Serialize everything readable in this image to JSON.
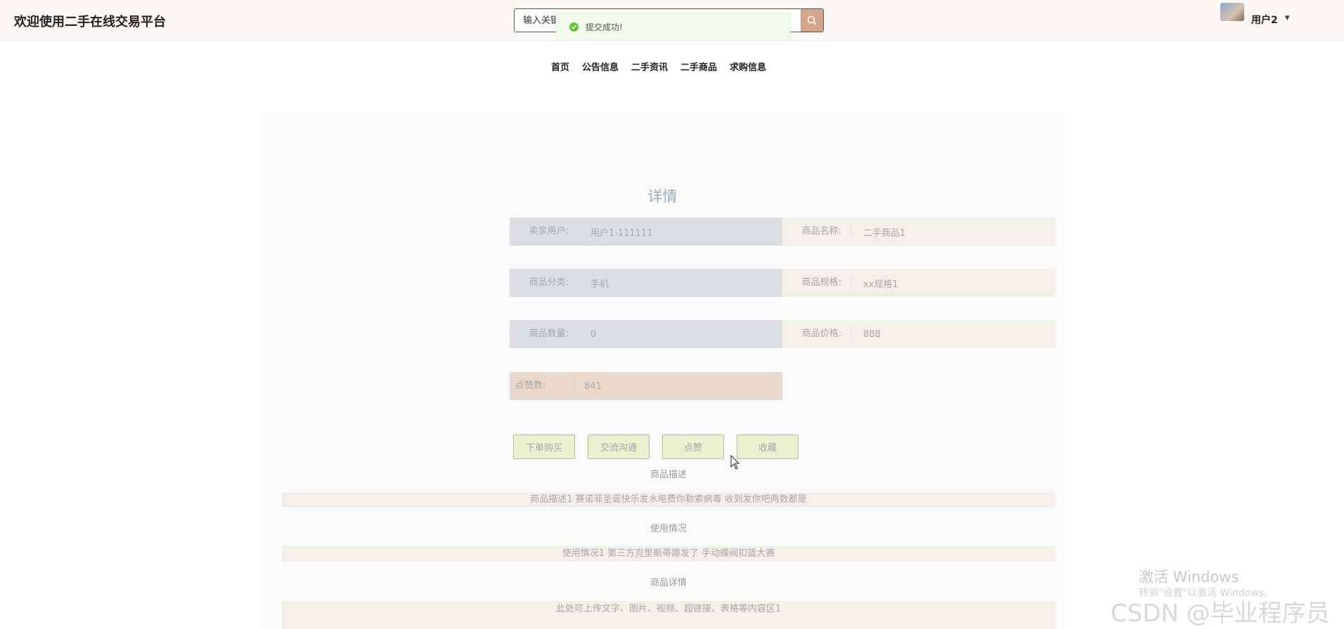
{
  "header": {
    "site_title": "欢迎使用二手在线交易平台",
    "search_placeholder": "输入关键",
    "user_name": "用户2",
    "toast": "提交成功!"
  },
  "nav": [
    "首页",
    "公告信息",
    "二手资讯",
    "二手商品",
    "求购信息"
  ],
  "detail": {
    "title": "详情",
    "fields": {
      "seller_label": "卖家用户:",
      "seller_value": "用户1-111111",
      "name_label": "商品名称:",
      "name_value": "二手商品1",
      "category_label": "商品分类:",
      "category_value": "手机",
      "spec_label": "商品规格:",
      "spec_value": "xx规格1",
      "qty_label": "商品数量:",
      "qty_value": "0",
      "price_label": "商品价格:",
      "price_value": "888",
      "likes_label": "点赞数:",
      "likes_value": "841"
    },
    "buttons": [
      "下单购买",
      "交流沟通",
      "点赞",
      "收藏"
    ],
    "sections": {
      "desc_title": "商品描述",
      "desc_body": "商品描述1 赛诺菲圣诞快乐发水电费你勒索病毒 收到发你吧两数都是",
      "usage_title": "使用情况",
      "usage_body": "使用情况1 第三方克里斯蒂娜发了 手动蝶阀扣篮大赛",
      "info_title": "商品详情",
      "info_body": "此处可上传文字、图片、视频、超链接、表格等内容区1"
    }
  },
  "watermark": {
    "activate": "激活 Windows",
    "activate_sub": "转到\"设置\"以激活 Windows。",
    "csdn": "CSDN @毕业程序员"
  },
  "colors": {
    "accent": "#d4a58a",
    "toast_green": "#67c23a"
  },
  "icons": {
    "search": "search-icon",
    "success": "check-circle-icon",
    "caret": "caret-down-icon"
  }
}
